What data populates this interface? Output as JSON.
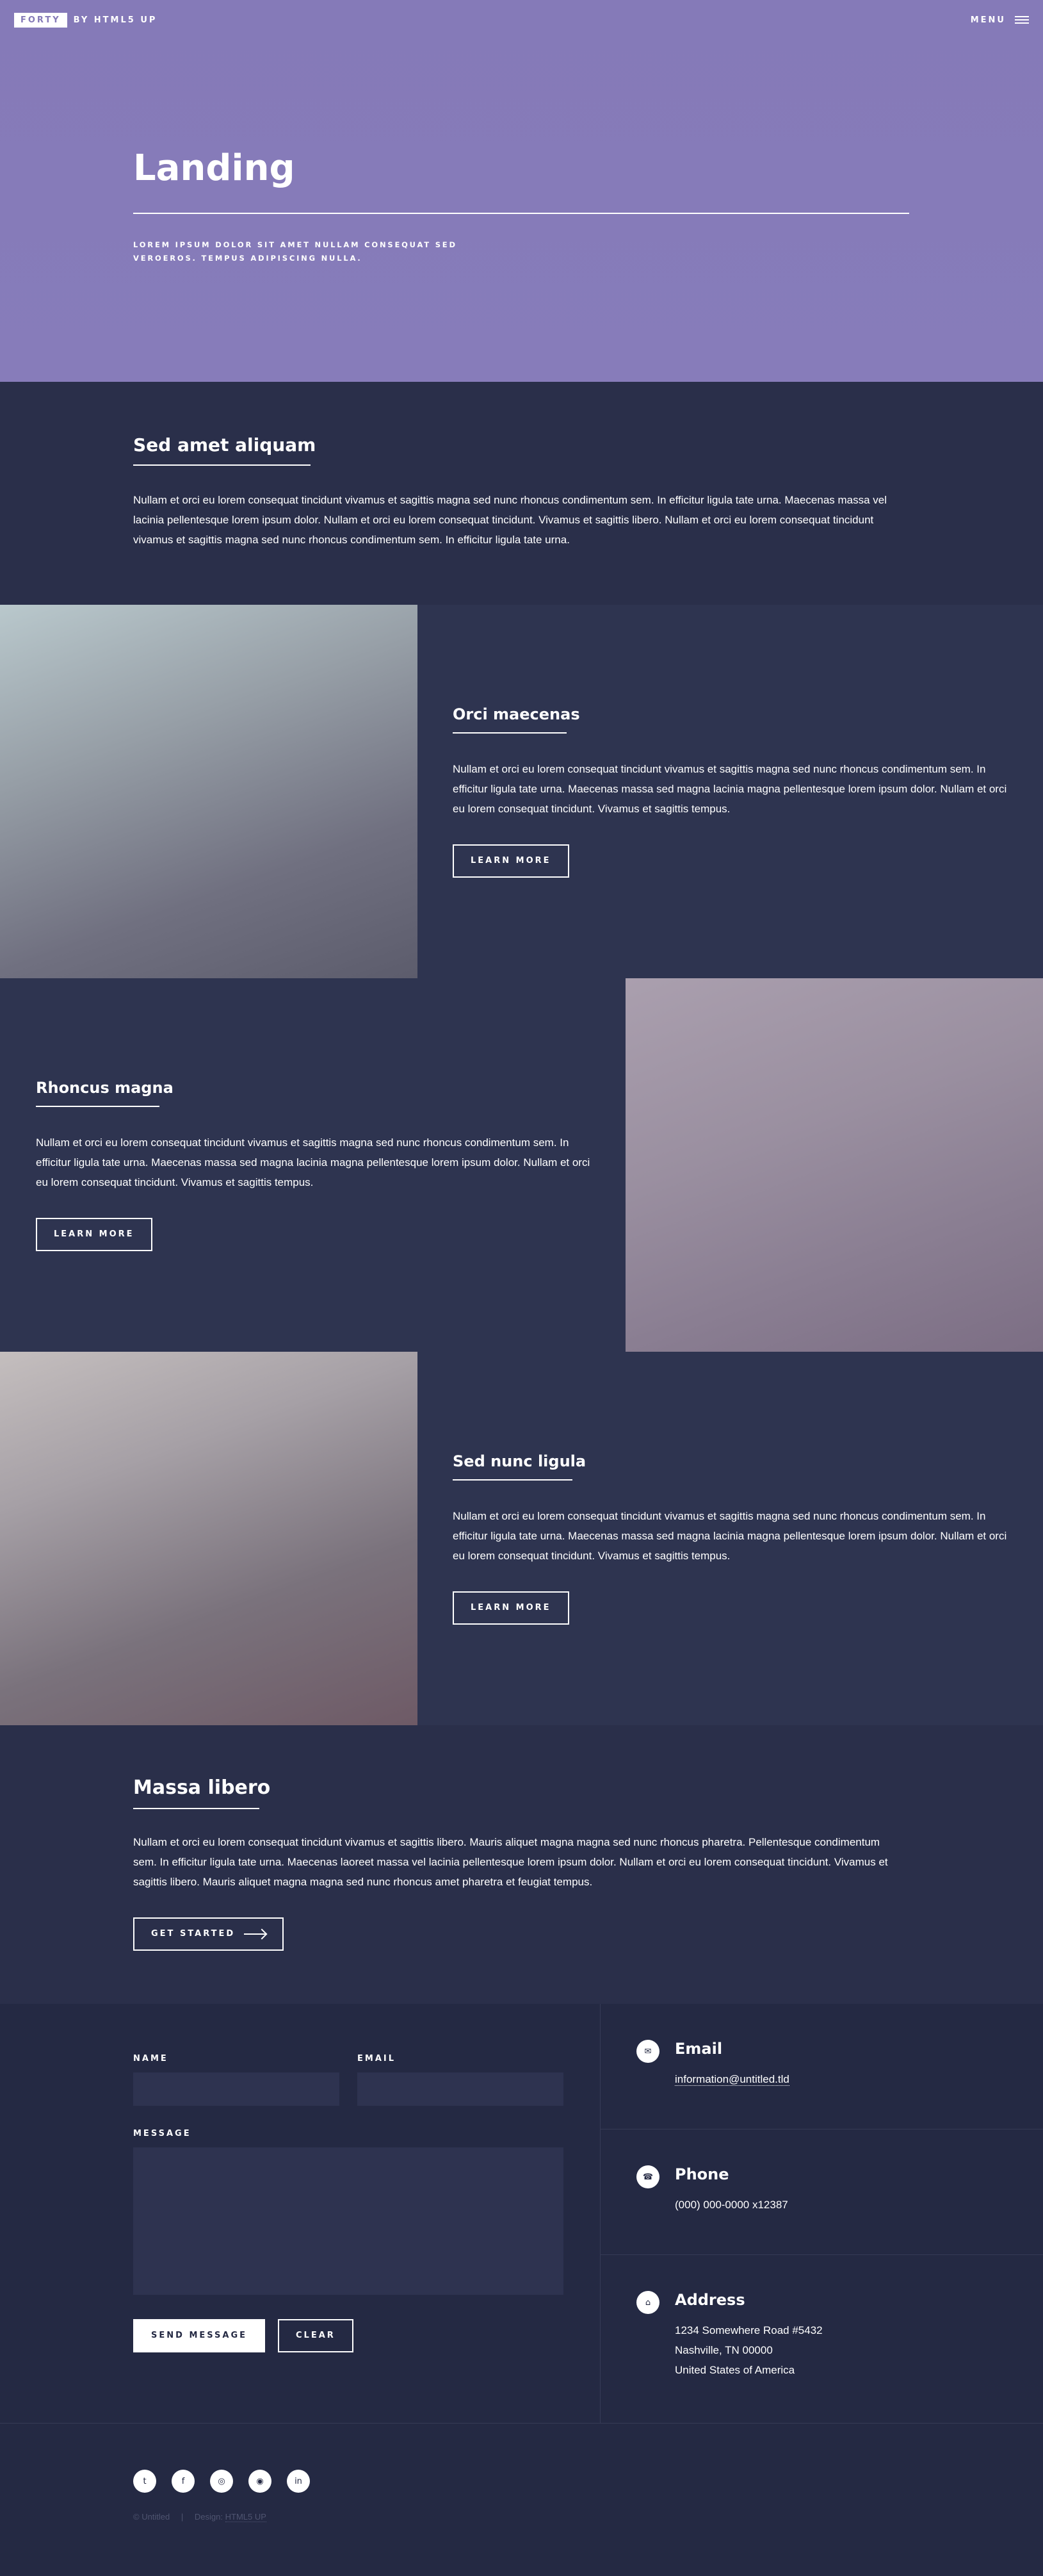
{
  "header": {
    "logo_box": "FORTY",
    "logo_by": "BY HTML5 UP",
    "menu_label": "MENU"
  },
  "banner": {
    "title": "Landing",
    "subtitle": "LOREM IPSUM DOLOR SIT AMET NULLAM CONSEQUAT SED VEROEROS. TEMPUS ADIPISCING NULLA."
  },
  "intro": {
    "title": "Sed amet aliquam",
    "text": "Nullam et orci eu lorem consequat tincidunt vivamus et sagittis magna sed nunc rhoncus condimentum sem. In efficitur ligula tate urna. Maecenas massa vel lacinia pellentesque lorem ipsum dolor. Nullam et orci eu lorem consequat tincidunt. Vivamus et sagittis libero. Nullam et orci eu lorem consequat tincidunt vivamus et sagittis magna sed nunc rhoncus condimentum sem. In efficitur ligula tate urna."
  },
  "spotlights": [
    {
      "title": "Orci maecenas",
      "text": "Nullam et orci eu lorem consequat tincidunt vivamus et sagittis magna sed nunc rhoncus condimentum sem. In efficitur ligula tate urna. Maecenas massa sed magna lacinia magna pellentesque lorem ipsum dolor. Nullam et orci eu lorem consequat tincidunt. Vivamus et sagittis tempus.",
      "button": "LEARN MORE"
    },
    {
      "title": "Rhoncus magna",
      "text": "Nullam et orci eu lorem consequat tincidunt vivamus et sagittis magna sed nunc rhoncus condimentum sem. In efficitur ligula tate urna. Maecenas massa sed magna lacinia magna pellentesque lorem ipsum dolor. Nullam et orci eu lorem consequat tincidunt. Vivamus et sagittis tempus.",
      "button": "LEARN MORE"
    },
    {
      "title": "Sed nunc ligula",
      "text": "Nullam et orci eu lorem consequat tincidunt vivamus et sagittis magna sed nunc rhoncus condimentum sem. In efficitur ligula tate urna. Maecenas massa sed magna lacinia magna pellentesque lorem ipsum dolor. Nullam et orci eu lorem consequat tincidunt. Vivamus et sagittis tempus.",
      "button": "LEARN MORE"
    }
  ],
  "massa": {
    "title": "Massa libero",
    "text": "Nullam et orci eu lorem consequat tincidunt vivamus et sagittis libero. Mauris aliquet magna magna sed nunc rhoncus pharetra. Pellentesque condimentum sem. In efficitur ligula tate urna. Maecenas laoreet massa vel lacinia pellentesque lorem ipsum dolor. Nullam et orci eu lorem consequat tincidunt. Vivamus et sagittis libero. Mauris aliquet magna magna sed nunc rhoncus amet pharetra et feugiat tempus.",
    "button": "GET STARTED"
  },
  "contact_form": {
    "name_label": "NAME",
    "email_label": "EMAIL",
    "message_label": "MESSAGE",
    "send_button": "SEND MESSAGE",
    "clear_button": "CLEAR"
  },
  "contact_info": {
    "email": {
      "title": "Email",
      "value": "information@untitled.tld",
      "icon": "envelope-icon"
    },
    "phone": {
      "title": "Phone",
      "value": "(000) 000-0000 x12387",
      "icon": "phone-icon"
    },
    "address": {
      "title": "Address",
      "lines": [
        "1234 Somewhere Road #5432",
        "Nashville, TN 00000",
        "United States of America"
      ],
      "icon": "home-icon"
    }
  },
  "footer": {
    "social": [
      "twitter-icon",
      "facebook-icon",
      "instagram-icon",
      "github-icon",
      "linkedin-icon"
    ],
    "copyright": "© Untitled",
    "design_label": "Design:",
    "design_credit": "HTML5 UP"
  },
  "colors": {
    "banner": "#857ab8",
    "dark_bg": "#242943",
    "section_bg": "#2a2f4a",
    "spot_bg": "#2e3450"
  }
}
